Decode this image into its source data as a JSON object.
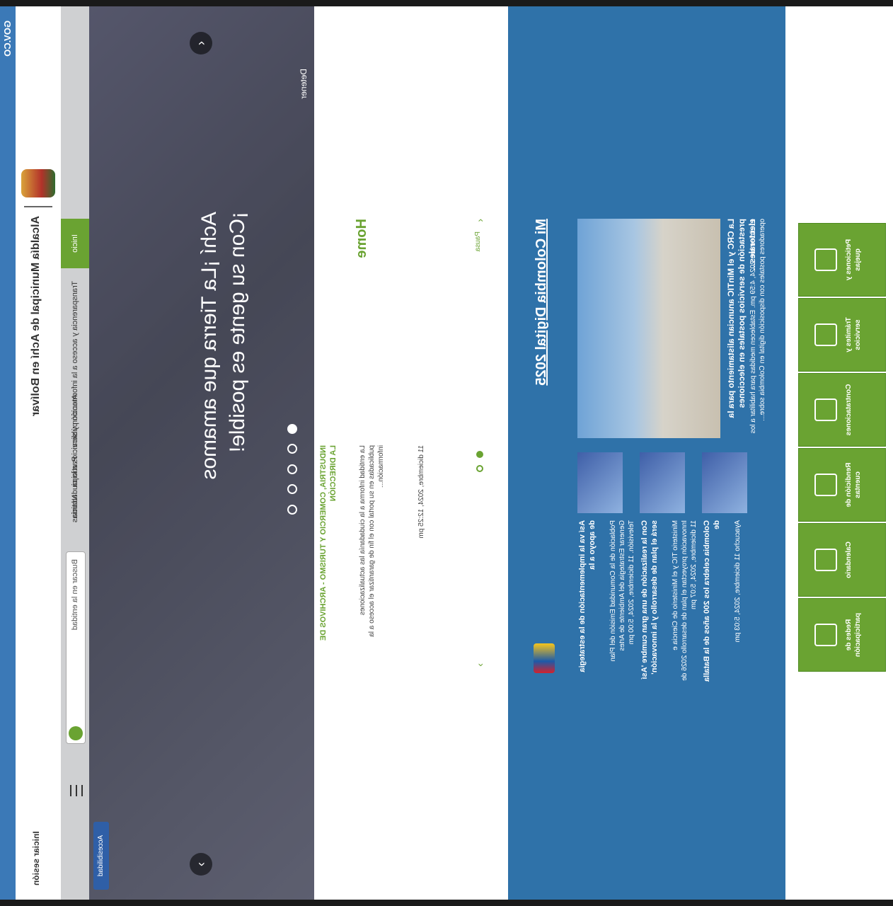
{
  "gov": {
    "logo_text": "GOV.CO"
  },
  "brand": {
    "title": "Alcaldía Municipal de Achí en Bolívar",
    "login_label": "Iniciar sesión"
  },
  "nav": {
    "home_label": "Inicio",
    "items": [
      "Transparencia y acceso a la información pública",
      "Atención y servicios a la ciudadanía",
      "Participa",
      "Noticias",
      "Información"
    ],
    "search_placeholder": "Buscar en la entidad"
  },
  "hero": {
    "headline_line1": "Achí ¡La Tierra que amamos",
    "headline_line2": "¡Con su gente es posible!",
    "pause_label": "Detener",
    "slide_count": 5,
    "active_slide": 1,
    "a11y_label": "Accesibilidad"
  },
  "news": {
    "section_title": "Home",
    "pause_label": "Pausa",
    "headline": "INDUSTRIA, COMERCIO Y TURISMO - ARCHIVOS DE LA DIRECCIÓN",
    "body": "La entidad informa a la ciudadanía las actualizaciones publicadas en su portal con el fin de garantizar el acceso a la información...",
    "date": "11 diciembre, 2024, 12:25 pm"
  },
  "mcd": {
    "heading": "Mi Colombia Digital 2025",
    "feature_title": "La CRC y el MinTIC anuncian alistamiento para la prestación de servicios postales en elecciones electorales...",
    "feature_body": "11 diciembre 2024, 4:59 pm. Establecen medidas para habilitar a los operadores postales con disposición digital en Colombia sobre...",
    "cards": [
      {
        "title": "Así va la implementación de la estrategia de apoyo a la",
        "body": "Población de la Comunidad Emisión del Plan Generar Estrategia del Ambiente de Artes Televisión. 11 diciembre, 2024, 5:00 pm"
      },
      {
        "title": "Con la realización de una gran cumbre 'Así será el plan de desarrollo y la innovación'",
        "body": "Ministerio TIC y el Ministerio de Ciencia e Innovación proyectan el plan de desarrollo 2026 de 11 diciembre, 2024, 5:07 pm"
      },
      {
        "title": "Colombia celebra los 200 años de la Batalla de",
        "body": "Ayacucho 11 diciembre, 2024, 5:03 pm"
      }
    ]
  },
  "services": [
    {
      "label": "Peticiones y quejas",
      "icon": "document-icon"
    },
    {
      "label": "Trámites y servicios",
      "icon": "chevron-icon"
    },
    {
      "label": "Contrataciones",
      "icon": "contract-icon"
    },
    {
      "label": "Rendición de cuentas",
      "icon": "chart-icon"
    },
    {
      "label": "Calendario",
      "icon": "calendar-icon"
    },
    {
      "label": "Redes de participación",
      "icon": "hand-icon"
    }
  ],
  "colors": {
    "gov_blue": "#3b79b7",
    "accent_green": "#6aa332",
    "section_blue": "#2f72a9",
    "nav_gray": "#cfd0d2"
  }
}
